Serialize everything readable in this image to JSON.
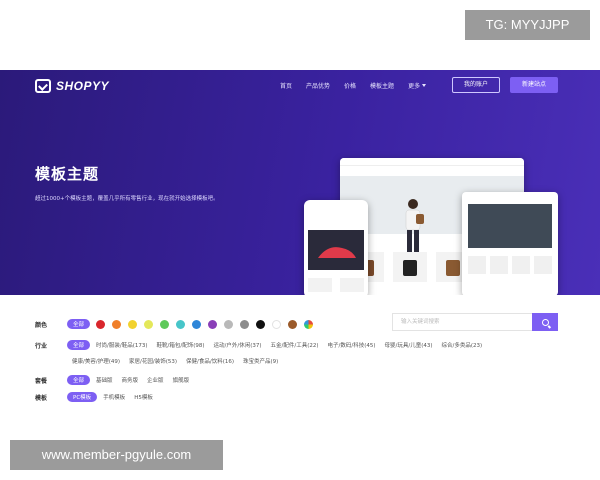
{
  "watermarks": {
    "top": "TG: MYYJJPP",
    "bottom": "www.member-pgyule.com"
  },
  "logo": {
    "text": "SHOPYY"
  },
  "nav": {
    "items": [
      "首页",
      "产品优势",
      "价格",
      "模板主题"
    ],
    "more": "更多",
    "login": "我的账户",
    "new_site": "新建站点"
  },
  "hero": {
    "title": "模板主题",
    "subtitle": "超过1000+个模板主题，覆盖几乎所有零售行业，现在就开始选择模板吧。"
  },
  "filters": {
    "color": {
      "label": "颜色",
      "all": "全部",
      "swatches": [
        "#d9262c",
        "#f07f2a",
        "#f2d22e",
        "#e4e85a",
        "#5ec95a",
        "#47c5c9",
        "#2f86d8",
        "#8a3fb8",
        "#b9b9b9",
        "#8c8c8c",
        "#111111",
        "#ffffff",
        "#9b5a2a",
        "#7fbf4a"
      ]
    },
    "industry": {
      "label": "行业",
      "all": "全部",
      "items_row1": [
        "时尚/服装/鞋品(173)",
        "鞋靴/箱包/配饰(98)",
        "运动/户外/休闲(37)",
        "五金/配件/工具(22)",
        "电子/数码/科技(45)",
        "母婴/玩具/儿童(43)",
        "综合/多类品(23)"
      ],
      "items_row2": [
        "健康/美容/护理(49)",
        "家居/花园/装饰(53)",
        "保健/食品/饮料(16)",
        "珠宝类产品(9)"
      ]
    },
    "package": {
      "label": "套餐",
      "all": "全部",
      "items": [
        "基础版",
        "商务版",
        "企业版",
        "旗舰版"
      ]
    },
    "template": {
      "label": "模板",
      "active": "PC模板",
      "items": [
        "手机模板",
        "H5模板"
      ]
    },
    "search": {
      "placeholder": "输入关键词搜索"
    }
  }
}
